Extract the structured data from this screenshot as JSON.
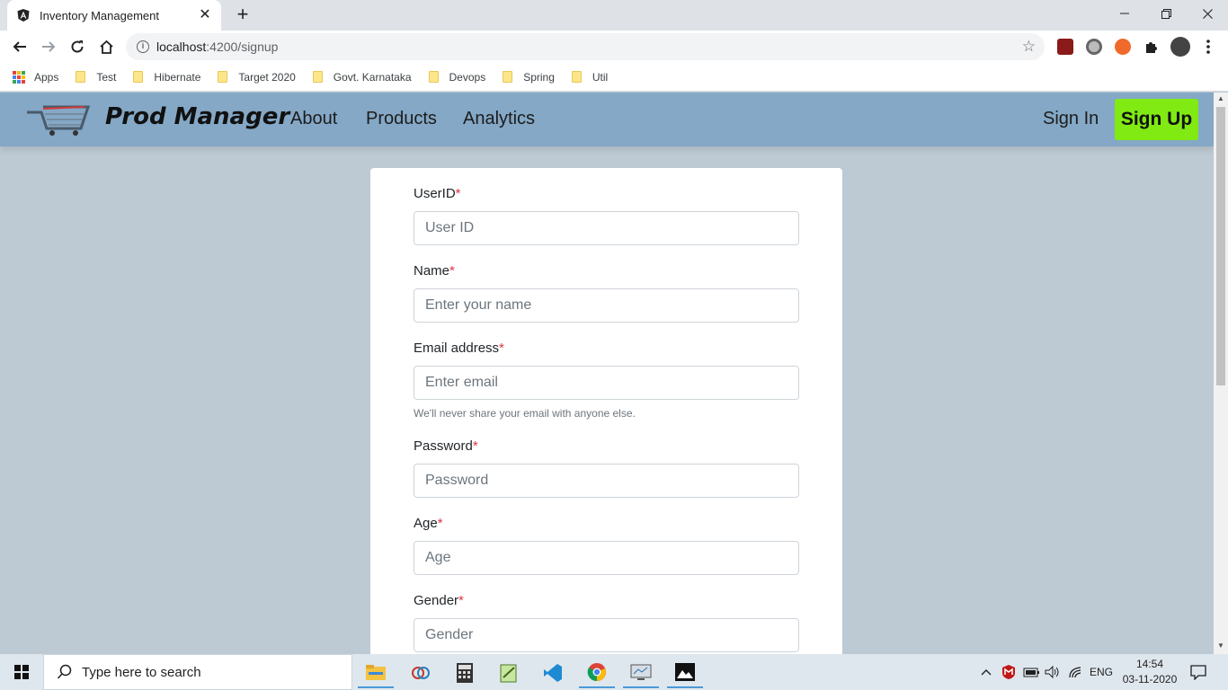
{
  "browser": {
    "tab_title": "Inventory Management",
    "new_tab": "+",
    "url_host": "localhost",
    "url_path": ":4200/signup",
    "bookmarks": [
      "Apps",
      "Test",
      "Hibernate",
      "Target 2020",
      "Govt. Karnataka",
      "Devops",
      "Spring",
      "Util"
    ]
  },
  "navbar": {
    "brand": "Prod Manager",
    "links": [
      "About",
      "Products",
      "Analytics"
    ],
    "sign_in": "Sign In",
    "sign_up": "Sign Up",
    "signup_color": "#80ea12",
    "bg_color": "#84a8c6"
  },
  "form": {
    "fields": [
      {
        "label": "UserID",
        "placeholder": "User ID"
      },
      {
        "label": "Name",
        "placeholder": "Enter your name"
      },
      {
        "label": "Email address",
        "placeholder": "Enter email",
        "help": "We'll never share your email with anyone else."
      },
      {
        "label": "Password",
        "placeholder": "Password"
      },
      {
        "label": "Age",
        "placeholder": "Age"
      },
      {
        "label": "Gender",
        "placeholder": "Gender"
      }
    ],
    "required_mark": "*"
  },
  "taskbar": {
    "search_placeholder": "Type here to search",
    "lang": "ENG",
    "time": "14:54",
    "date": "03-11-2020"
  }
}
